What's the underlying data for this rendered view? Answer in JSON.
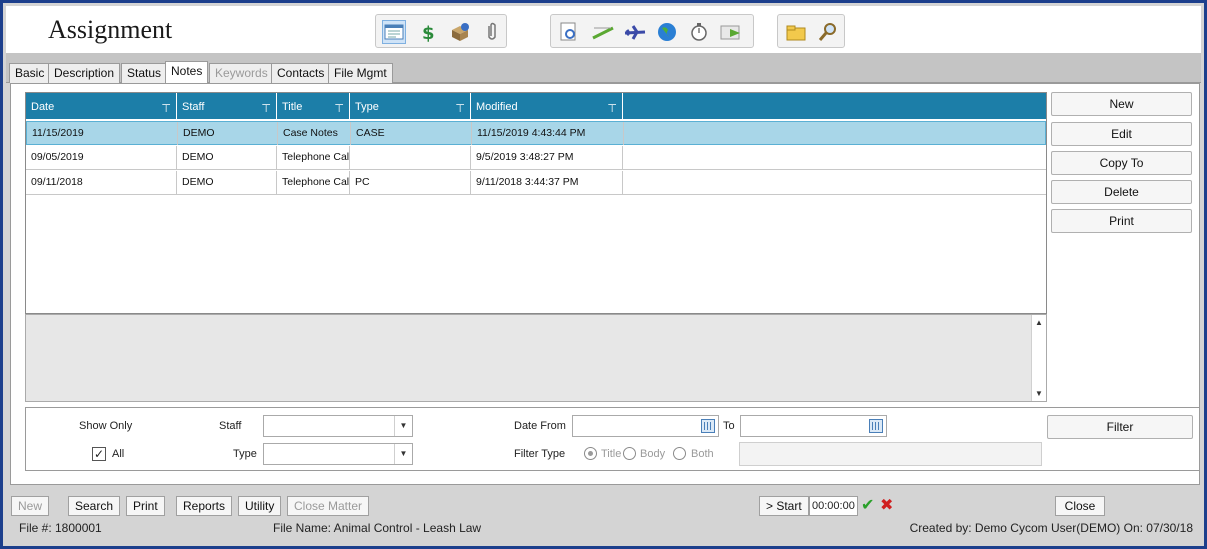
{
  "window": {
    "title": "Assignment"
  },
  "toolbar": {
    "groups": [
      [
        "notes-icon",
        "dollar-icon",
        "box-icon",
        "paperclip-icon"
      ],
      [
        "preview-doc-icon",
        "ruler-pencil-icon",
        "airplane-icon",
        "globe-icon",
        "stopwatch-icon",
        "mail-arrow-icon"
      ],
      [
        "folder-icon",
        "magnifier-icon"
      ]
    ]
  },
  "tabs": [
    {
      "label": "Basic",
      "state": "normal"
    },
    {
      "label": "Description",
      "state": "normal"
    },
    {
      "label": "Status",
      "state": "normal"
    },
    {
      "label": "Notes",
      "state": "active"
    },
    {
      "label": "Keywords",
      "state": "disabled"
    },
    {
      "label": "Contacts",
      "state": "normal"
    },
    {
      "label": "File Mgmt",
      "state": "normal"
    }
  ],
  "grid": {
    "columns": [
      "Date",
      "Staff",
      "Title",
      "Type",
      "Modified"
    ],
    "rows": [
      [
        "11/15/2019",
        "DEMO",
        "Case Notes",
        "CASE",
        "11/15/2019 4:43:44 PM"
      ],
      [
        "09/05/2019",
        "DEMO",
        "Telephone Call",
        "",
        "9/5/2019 3:48:27 PM"
      ],
      [
        "09/11/2018",
        "DEMO",
        "Telephone Call",
        "PC",
        "9/11/2018 3:44:37 PM"
      ]
    ],
    "selected_row": 0
  },
  "side_buttons": [
    "New",
    "Edit",
    "Copy To",
    "Delete",
    "Print"
  ],
  "filter": {
    "show_only_label": "Show Only",
    "all_label": "All",
    "all_checked": true,
    "staff_label": "Staff",
    "staff_value": "",
    "type_label": "Type",
    "type_value": "",
    "date_from_label": "Date From",
    "to_label": "To",
    "filter_type_label": "Filter Type",
    "radio_title": "Title",
    "radio_body": "Body",
    "radio_both": "Both",
    "selected_radio": "Title",
    "filter_button": "Filter"
  },
  "bottom": {
    "buttons": [
      {
        "label": "New",
        "disabled": true
      },
      {
        "label": "Search",
        "disabled": false
      },
      {
        "label": "Print",
        "disabled": false
      },
      {
        "label": "Reports",
        "disabled": false
      },
      {
        "label": "Utility",
        "disabled": false
      },
      {
        "label": "Close Matter",
        "disabled": true
      }
    ],
    "start_label": "> Start",
    "timer": "00:00:00",
    "close_label": "Close"
  },
  "status": {
    "file_number": "File #: 1800001",
    "file_name": "File Name: Animal Control - Leash Law",
    "created_by": "Created by: Demo Cycom User(DEMO) On: 07/30/18"
  },
  "colors": {
    "header": "#1c7ea8",
    "selected_row": "#a8d6e8",
    "frame_border": "#1c3f8c"
  }
}
